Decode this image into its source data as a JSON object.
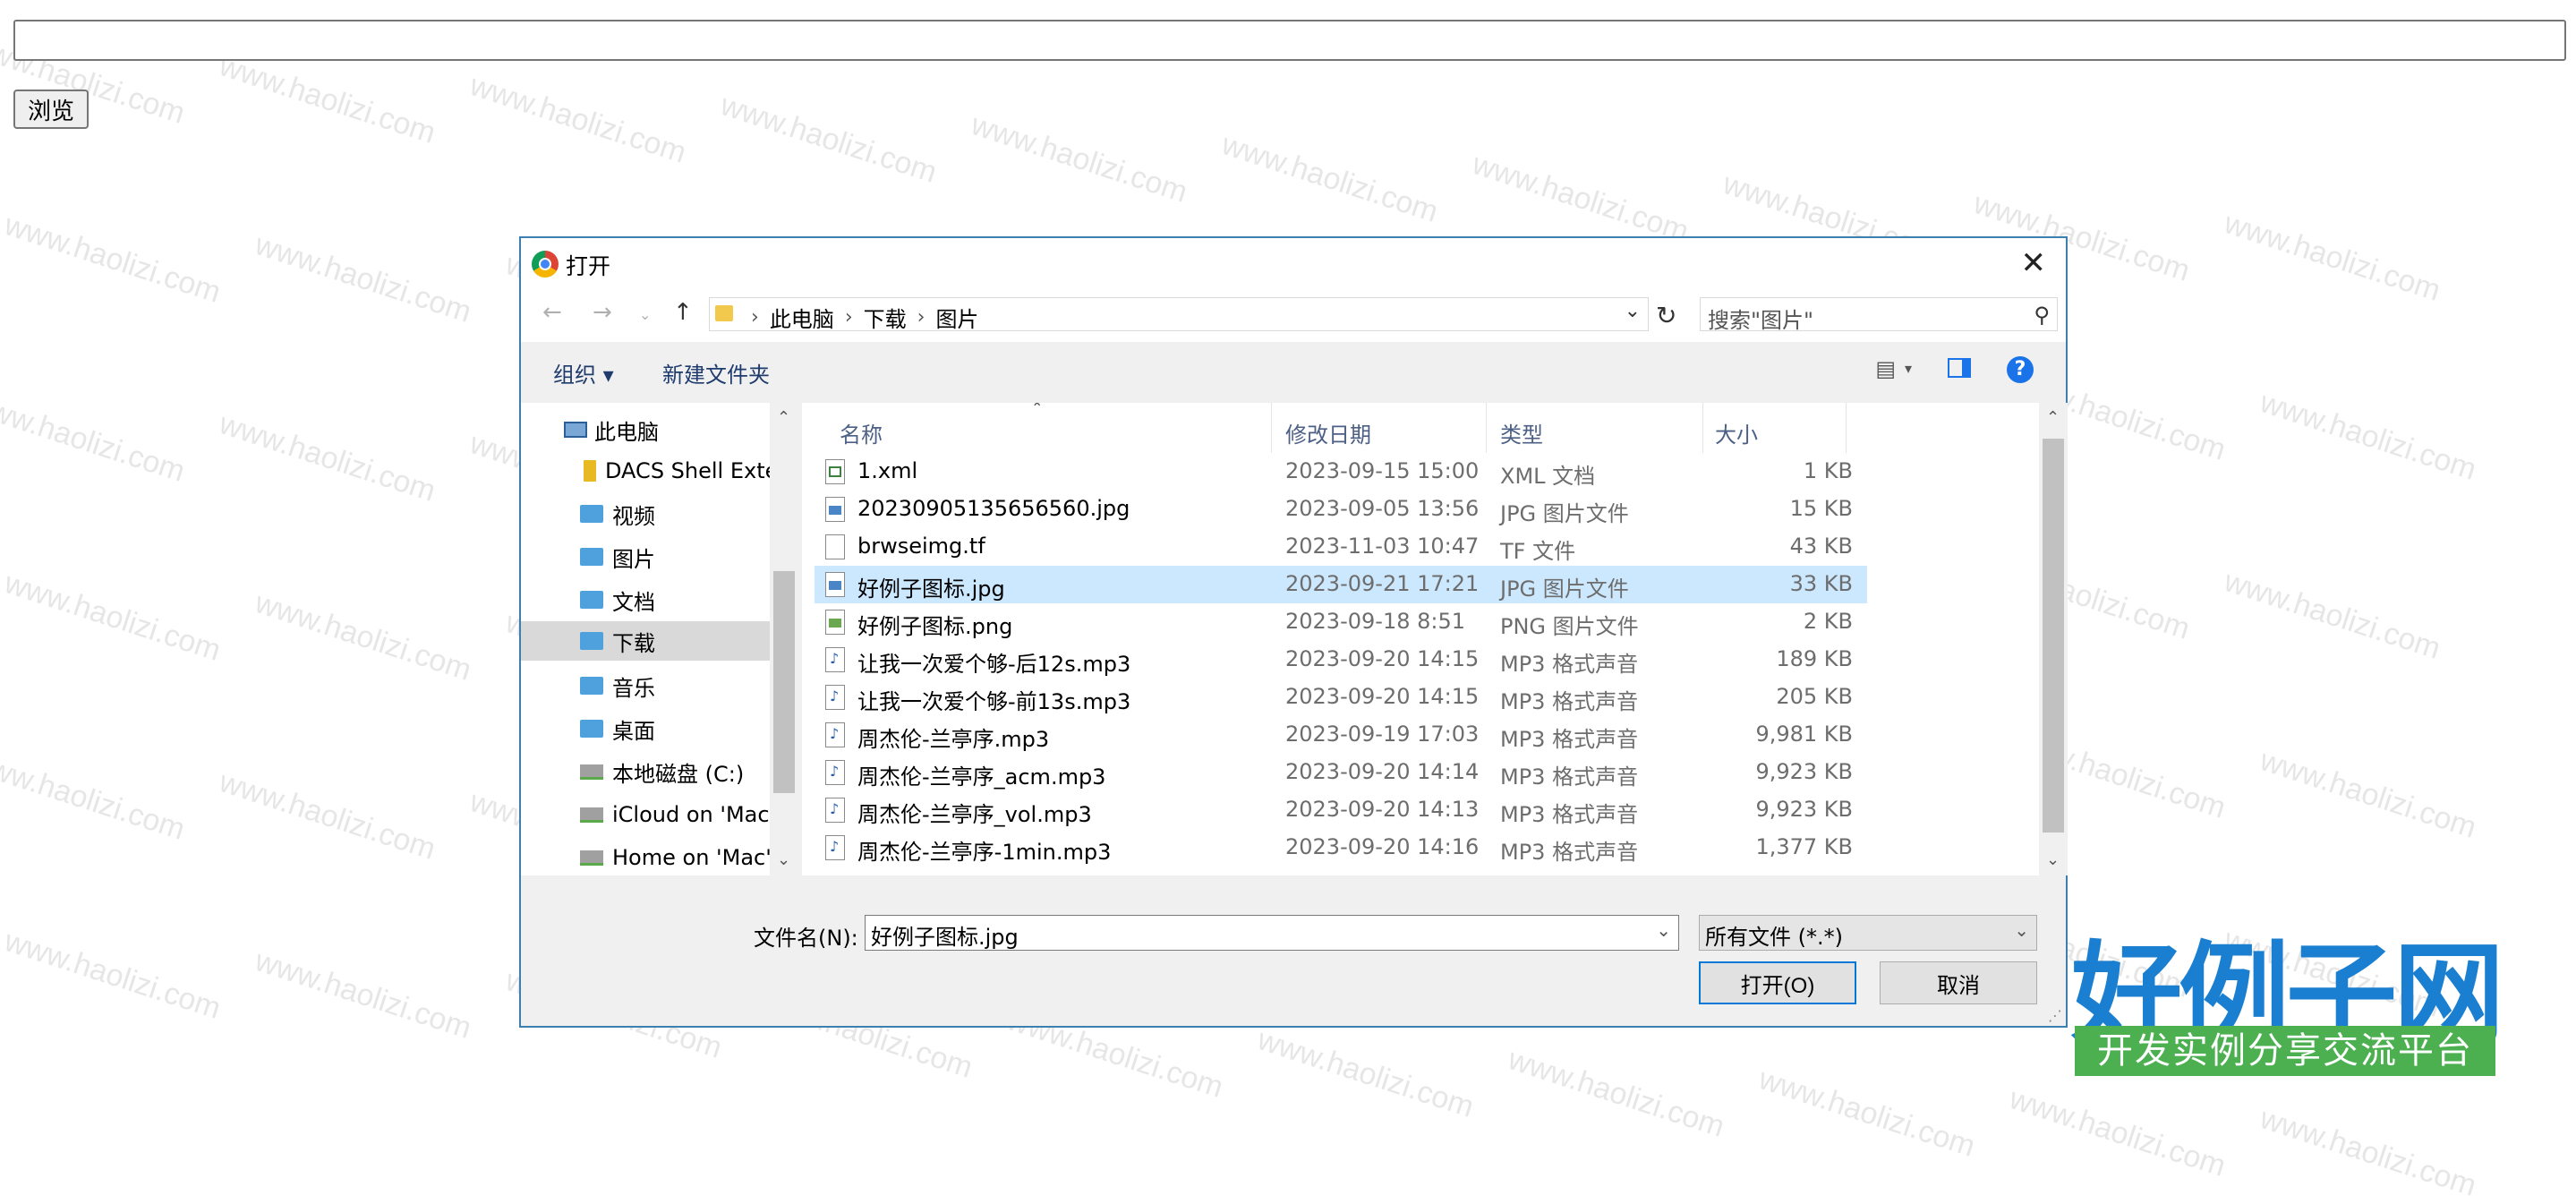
{
  "page": {
    "browse_label": "浏览",
    "watermark_text": "www.haolizi.com"
  },
  "dialog": {
    "title": "打开",
    "breadcrumb": [
      "此电脑",
      "下载",
      "图片"
    ],
    "search_placeholder": "搜索\"图片\"",
    "toolbar": {
      "organize": "组织",
      "new_folder": "新建文件夹"
    },
    "nav_items": [
      {
        "label": "此电脑",
        "icon": "pc-icon"
      },
      {
        "label": "DACS Shell Exte",
        "icon": "folder-yellow-icon"
      },
      {
        "label": "视频",
        "icon": "folder-icon"
      },
      {
        "label": "图片",
        "icon": "folder-icon"
      },
      {
        "label": "文档",
        "icon": "folder-icon"
      },
      {
        "label": "下载",
        "icon": "folder-icon",
        "selected": true
      },
      {
        "label": "音乐",
        "icon": "folder-icon"
      },
      {
        "label": "桌面",
        "icon": "folder-icon"
      },
      {
        "label": "本地磁盘 (C:)",
        "icon": "drive-icon"
      },
      {
        "label": "iCloud on 'Mac'",
        "icon": "network-drive-icon"
      },
      {
        "label": "Home on 'Mac'",
        "icon": "network-drive-icon"
      }
    ],
    "columns": [
      "名称",
      "修改日期",
      "类型",
      "大小"
    ],
    "files": [
      {
        "name": "1.xml",
        "date": "2023-09-15 15:00",
        "type": "XML 文档",
        "size": "1 KB",
        "icon": "xml"
      },
      {
        "name": "20230905135656560.jpg",
        "date": "2023-09-05 13:56",
        "type": "JPG 图片文件",
        "size": "15 KB",
        "icon": "img"
      },
      {
        "name": "brwseimg.tf",
        "date": "2023-11-03 10:47",
        "type": "TF 文件",
        "size": "43 KB",
        "icon": "blank"
      },
      {
        "name": "好例子图标.jpg",
        "date": "2023-09-21 17:21",
        "type": "JPG 图片文件",
        "size": "33 KB",
        "icon": "img",
        "selected": true
      },
      {
        "name": "好例子图标.png",
        "date": "2023-09-18 8:51",
        "type": "PNG 图片文件",
        "size": "2 KB",
        "icon": "png"
      },
      {
        "name": "让我一次爱个够-后12s.mp3",
        "date": "2023-09-20 14:15",
        "type": "MP3 格式声音",
        "size": "189 KB",
        "icon": "mp3"
      },
      {
        "name": "让我一次爱个够-前13s.mp3",
        "date": "2023-09-20 14:15",
        "type": "MP3 格式声音",
        "size": "205 KB",
        "icon": "mp3"
      },
      {
        "name": "周杰伦-兰亭序.mp3",
        "date": "2023-09-19 17:03",
        "type": "MP3 格式声音",
        "size": "9,981 KB",
        "icon": "mp3"
      },
      {
        "name": "周杰伦-兰亭序_acm.mp3",
        "date": "2023-09-20 14:14",
        "type": "MP3 格式声音",
        "size": "9,923 KB",
        "icon": "mp3"
      },
      {
        "name": "周杰伦-兰亭序_vol.mp3",
        "date": "2023-09-20 14:13",
        "type": "MP3 格式声音",
        "size": "9,923 KB",
        "icon": "mp3"
      },
      {
        "name": "周杰伦-兰亭序-1min.mp3",
        "date": "2023-09-20 14:16",
        "type": "MP3 格式声音",
        "size": "1,377 KB",
        "icon": "mp3"
      }
    ],
    "filename_label": "文件名(N):",
    "filename_value": "好例子图标.jpg",
    "filter_value": "所有文件 (*.*)",
    "open_label": "打开(O)",
    "cancel_label": "取消"
  },
  "logo": {
    "main": "好例子网",
    "sub": "开发实例分享交流平台"
  }
}
